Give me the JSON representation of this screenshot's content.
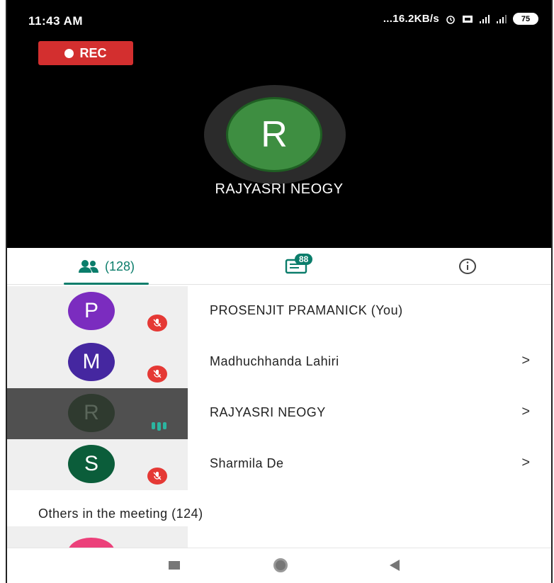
{
  "status_bar": {
    "time": "11:43 AM",
    "network_speed": "...16.2KB/s",
    "battery": "75"
  },
  "recording": {
    "label": "REC"
  },
  "active_speaker": {
    "initial": "R",
    "name": "RAJYASRI NEOGY"
  },
  "tabs": {
    "people_count": "(128)",
    "chat_badge": "88"
  },
  "participants": [
    {
      "initial": "P",
      "name": "PROSENJIT PRAMANICK (You)",
      "color": "#7b2cbf",
      "muted": true,
      "chevron": ""
    },
    {
      "initial": "M",
      "name": "Madhuchhanda Lahiri",
      "color": "#4527a0",
      "muted": true,
      "chevron": ">"
    },
    {
      "initial": "R",
      "name": "RAJYASRI NEOGY",
      "color": "#2f3a2f",
      "muted": false,
      "chevron": ">"
    },
    {
      "initial": "S",
      "name": "Sharmila De",
      "color": "#0b5d3a",
      "muted": true,
      "chevron": ">"
    }
  ],
  "others_label": "Others in the meeting (124)"
}
